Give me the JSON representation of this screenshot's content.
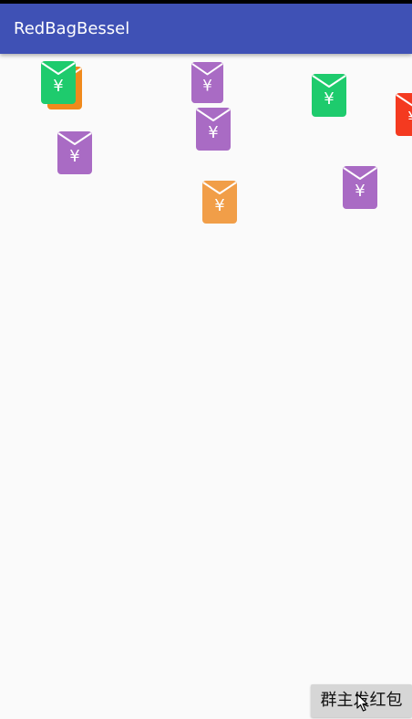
{
  "app": {
    "title": "RedBagBessel"
  },
  "actions": {
    "send_button_label": "群主发红包"
  },
  "colors": {
    "toolbar": "#3f51b5",
    "background": "#fafafa",
    "green": "#1ecb6d",
    "orange": "#f19e48",
    "dark_orange": "#f08a1c",
    "purple": "#a96bc4",
    "red": "#f43a20"
  },
  "envelope_symbol": "¥",
  "envelopes": [
    {
      "color": "dark_orange"
    },
    {
      "color": "green"
    },
    {
      "color": "purple"
    },
    {
      "color": "green"
    },
    {
      "color": "red"
    },
    {
      "color": "purple"
    },
    {
      "color": "purple"
    },
    {
      "color": "purple"
    },
    {
      "color": "orange"
    }
  ],
  "icons": {
    "cursor": "mouse-pointer-icon",
    "envelope": "red-envelope-icon"
  }
}
